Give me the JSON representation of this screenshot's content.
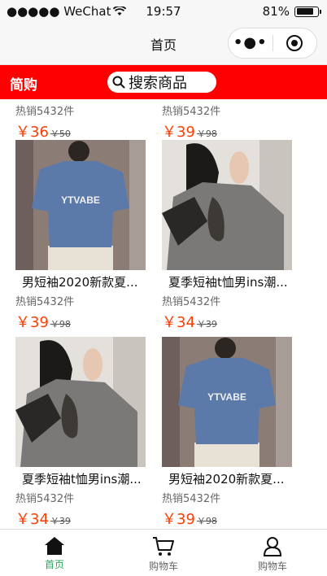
{
  "status_bar": {
    "carrier": "●●●●● WeChat",
    "time": "19:57",
    "battery_text": "81%",
    "battery_level": 0.81
  },
  "nav": {
    "title": "首页",
    "more_glyph": "•●•"
  },
  "header": {
    "brand": "简购",
    "search_text": "搜索商品"
  },
  "products": {
    "top_partial": [
      {
        "sold": "热销5432件",
        "price": "￥36",
        "old_price": "￥50"
      },
      {
        "sold": "热销5432件",
        "price": "￥39",
        "old_price": "￥98"
      }
    ],
    "items": [
      {
        "name": "男短袖2020新款夏...",
        "sold": "热销5432件",
        "price": "￥39",
        "old_price": "￥98",
        "image": "blue-tshirt"
      },
      {
        "name": "夏季短袖t恤男ins潮...",
        "sold": "热销5432件",
        "price": "￥34",
        "old_price": "￥39",
        "image": "grey-tshirt"
      },
      {
        "name": "夏季短袖t恤男ins潮...",
        "sold": "热销5432件",
        "price": "￥34",
        "old_price": "￥39",
        "image": "grey-tshirt"
      },
      {
        "name": "男短袖2020新款夏...",
        "sold": "热销5432件",
        "price": "￥39",
        "old_price": "￥98",
        "image": "blue-tshirt"
      }
    ],
    "shirt_print": "YTVABE"
  },
  "tabbar": {
    "tabs": [
      {
        "label": "首页",
        "icon": "home-icon",
        "active": true
      },
      {
        "label": "购物车",
        "icon": "cart-icon",
        "active": false
      },
      {
        "label": "购物车",
        "icon": "user-icon",
        "active": false
      }
    ],
    "active_color": "#2fa35b"
  },
  "colors": {
    "header_red": "#ff0000",
    "price_red": "#ff3d00"
  }
}
